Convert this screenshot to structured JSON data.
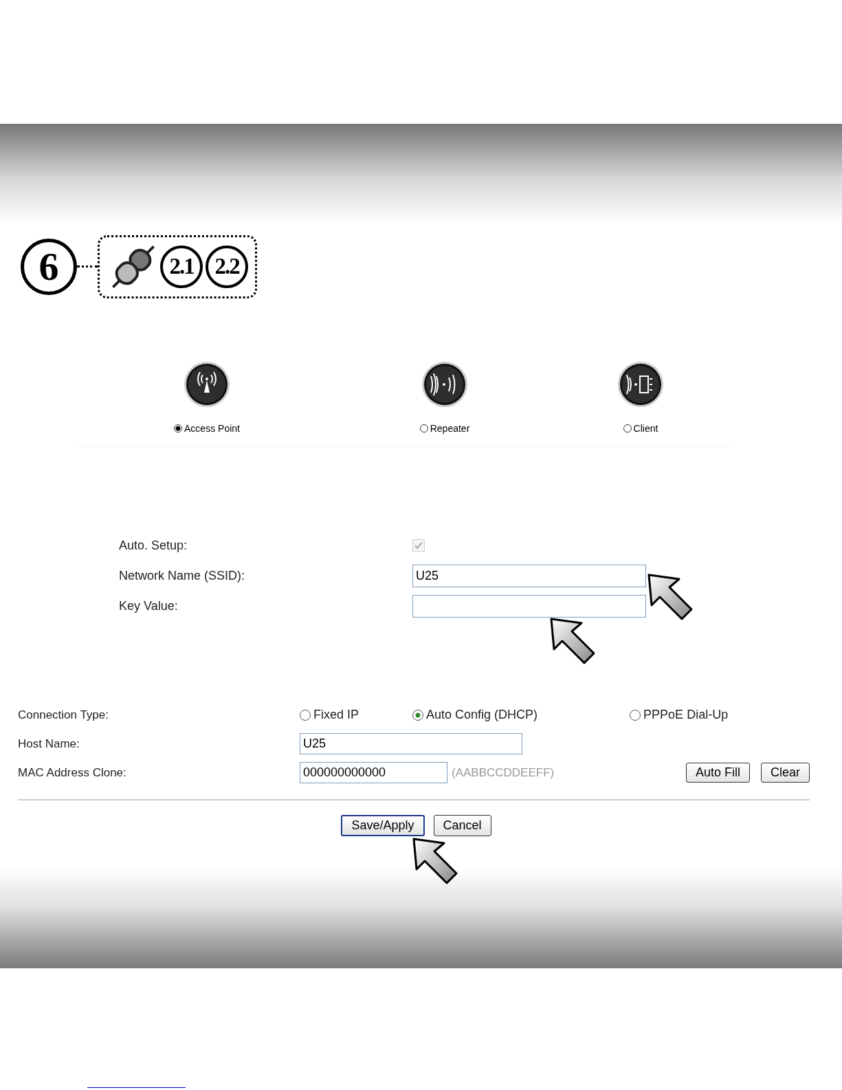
{
  "step": {
    "number": "6",
    "refs": [
      "2.1",
      "2.2"
    ]
  },
  "modes": [
    {
      "label": "Access Point",
      "selected": true,
      "kind": "tower"
    },
    {
      "label": "Repeater",
      "selected": false,
      "kind": "repeater"
    },
    {
      "label": "Client",
      "selected": false,
      "kind": "client"
    }
  ],
  "wireless": {
    "auto_setup": {
      "label": "Auto. Setup:",
      "checked": true,
      "disabled": true
    },
    "ssid": {
      "label": "Network Name (SSID):",
      "value": "U25"
    },
    "key": {
      "label": "Key Value:"
    }
  },
  "connection": {
    "label": "Connection Type:",
    "options": [
      {
        "label": "Fixed IP",
        "selected": false
      },
      {
        "label": "Auto Config (DHCP)",
        "selected": true
      },
      {
        "label": "PPPoE Dial-Up",
        "selected": false
      }
    ]
  },
  "host_name": {
    "label": "Host Name:",
    "value": "U25"
  },
  "mac_clone": {
    "label": "MAC Address Clone:",
    "value": "000000000000",
    "hint": "(AABBCCDDEEFF)",
    "buttons": [
      "Auto Fill",
      "Clear"
    ]
  },
  "actions": [
    {
      "label": "Save/Apply",
      "default": true
    },
    {
      "label": "Cancel",
      "default": false
    }
  ]
}
